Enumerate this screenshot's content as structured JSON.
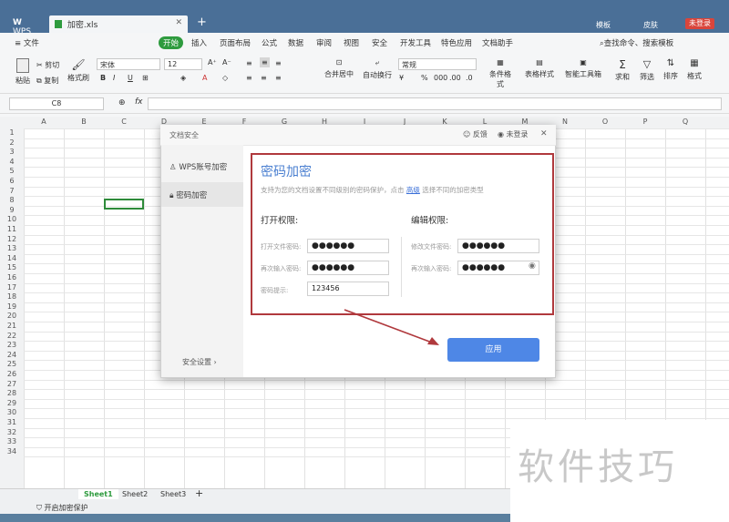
{
  "window": {
    "app_tab": "WPS",
    "file_tab": "加密.xls",
    "new_tab_symbol": "+",
    "right_items": [
      "模板",
      "皮肤",
      "未登录"
    ]
  },
  "menu": {
    "file": "文件",
    "items": [
      "开始",
      "插入",
      "页面布局",
      "公式",
      "数据",
      "审阅",
      "视图",
      "安全",
      "开发工具",
      "特色应用",
      "文档助手"
    ],
    "search": "查找命令、搜索模板"
  },
  "toolbar": {
    "paste": "粘贴",
    "cut": "剪切",
    "copy": "复制",
    "format_painter": "格式刷",
    "font": "宋体",
    "font_size": "12",
    "merge_center": "合并居中",
    "wrap": "自动换行",
    "number_format": "常规",
    "cond_format": "条件格式",
    "table_style": "表格样式",
    "smart_toolbox": "智能工具箱",
    "sum": "求和",
    "filter": "筛选",
    "sort": "排序",
    "format": "格式"
  },
  "formula_bar": {
    "name_box": "C8",
    "fx": "fx"
  },
  "grid": {
    "columns": [
      "A",
      "B",
      "C",
      "D",
      "E",
      "F",
      "G",
      "H",
      "I",
      "J",
      "K",
      "L",
      "M",
      "N",
      "O",
      "P",
      "Q"
    ],
    "rows": [
      "1",
      "2",
      "3",
      "4",
      "5",
      "6",
      "7",
      "8",
      "9",
      "10",
      "11",
      "12",
      "13",
      "14",
      "15",
      "16",
      "17",
      "18",
      "19",
      "20",
      "21",
      "22",
      "23",
      "24",
      "25",
      "26",
      "27",
      "28",
      "29",
      "30",
      "31",
      "32",
      "33",
      "34"
    ]
  },
  "sheets": {
    "tabs": [
      "Sheet1",
      "Sheet2",
      "Sheet3"
    ],
    "add": "+"
  },
  "status": {
    "encrypt_protect": "开启加密保护"
  },
  "dialog": {
    "title": "文档安全",
    "feedback": "反馈",
    "not_logged_in": "未登录",
    "close": "✕",
    "side_items": [
      "WPS账号加密",
      "密码加密"
    ],
    "security_settings": "安全设置",
    "heading": "密码加密",
    "description_prefix": "支持为您的文档设置不同级别的密码保护，点击",
    "advanced_link": "高级",
    "description_suffix": "选择不同的加密类型",
    "open_perm": {
      "title": "打开权限:",
      "password_label": "打开文件密码:",
      "password_value": "●●●●●●",
      "confirm_label": "再次输入密码:",
      "confirm_value": "●●●●●●",
      "hint_label": "密码提示:",
      "hint_value": "123456"
    },
    "edit_perm": {
      "title": "编辑权限:",
      "password_label": "修改文件密码:",
      "password_value": "●●●●●●",
      "confirm_label": "再次输入密码:",
      "confirm_value": "●●●●●●"
    },
    "apply": "应用"
  },
  "watermark": "软件技巧",
  "colors": {
    "accent_green": "#2e9b3e",
    "apply_blue": "#4e87e6",
    "highlight_red": "#b0393d",
    "link_blue": "#3a6fd8"
  }
}
